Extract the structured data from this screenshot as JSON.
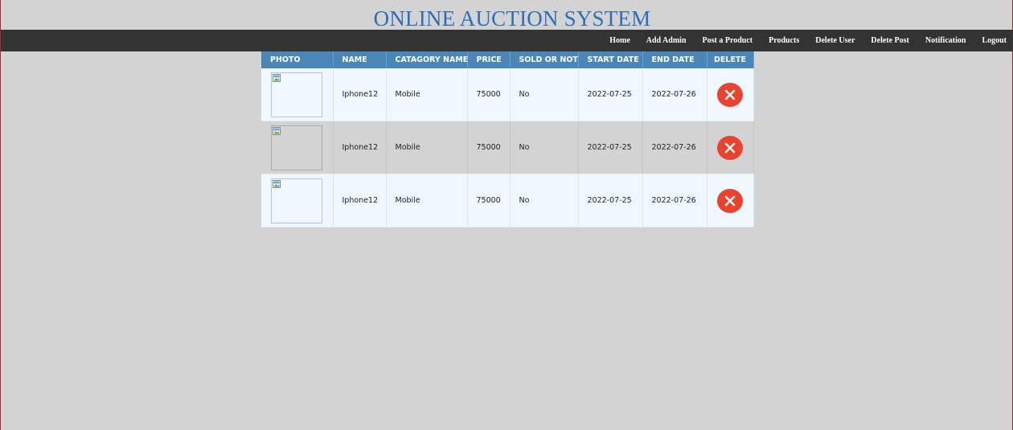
{
  "site": {
    "title": "ONLINE AUCTION SYSTEM"
  },
  "nav": {
    "items": [
      {
        "label": "Home"
      },
      {
        "label": "Add Admin"
      },
      {
        "label": "Post a Product"
      },
      {
        "label": "Products"
      },
      {
        "label": "Delete User"
      },
      {
        "label": "Delete Post"
      },
      {
        "label": "Notification"
      },
      {
        "label": "Logout"
      }
    ]
  },
  "table": {
    "headers": {
      "photo": "PHOTO",
      "name": "NAME",
      "category": "CATAGORY NAME",
      "price": "PRICE",
      "sold": "SOLD OR NOT",
      "start": "START DATE",
      "end": "END DATE",
      "delete": "DELETE"
    },
    "rows": [
      {
        "name": "Iphone12",
        "category": "Mobile",
        "price": "75000",
        "sold": "No",
        "start": "2022-07-25",
        "end": "2022-07-26"
      },
      {
        "name": "Iphone12",
        "category": "Mobile",
        "price": "75000",
        "sold": "No",
        "start": "2022-07-25",
        "end": "2022-07-26"
      },
      {
        "name": "Iphone12",
        "category": "Mobile",
        "price": "75000",
        "sold": "No",
        "start": "2022-07-25",
        "end": "2022-07-26"
      }
    ]
  },
  "icons": {
    "photo": "broken-image-icon",
    "delete": "close-icon"
  },
  "colors": {
    "title": "#2f6db5",
    "navbar": "#333333",
    "table_header": "#4a86b7",
    "row_light": "#f0f8ff",
    "row_dark": "#d3d3d3",
    "delete_button": "#e8432f",
    "page_background": "#d3d3d3"
  }
}
